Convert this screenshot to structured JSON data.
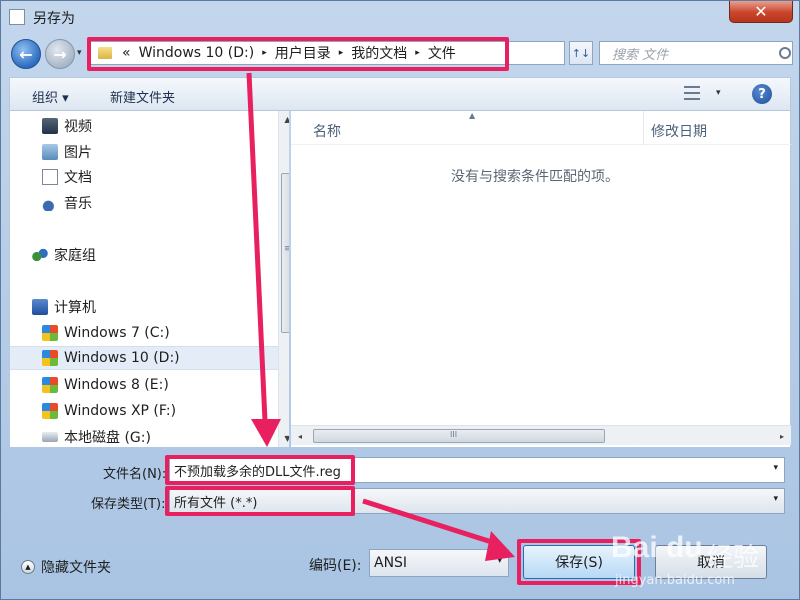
{
  "window": {
    "title": "另存为",
    "close_label": "✕"
  },
  "nav": {
    "back_glyph": "←",
    "forward_glyph": "→",
    "dropdown_glyph": "▾"
  },
  "address": {
    "prefix": "«",
    "crumbs": [
      "Windows 10 (D:)",
      "用户目录",
      "我的文档",
      "文件"
    ],
    "separator": "▸",
    "dropdown_glyph": "▾"
  },
  "refresh_glyph": "↑↓",
  "search": {
    "placeholder": "搜索 文件"
  },
  "toolbar": {
    "organize": "组织 ▾",
    "new_folder": "新建文件夹",
    "view_dropdown": "▾",
    "help": "?"
  },
  "sidebar": {
    "items": [
      {
        "label": "视频",
        "icon": "video-icon"
      },
      {
        "label": "图片",
        "icon": "pictures-icon"
      },
      {
        "label": "文档",
        "icon": "documents-icon"
      },
      {
        "label": "音乐",
        "icon": "music-icon"
      },
      {
        "label": "家庭组",
        "icon": "homegroup-icon"
      },
      {
        "label": "计算机",
        "icon": "computer-icon"
      },
      {
        "label": "Windows 7 (C:)",
        "icon": "drive-icon"
      },
      {
        "label": "Windows 10 (D:)",
        "icon": "drive-icon",
        "selected": true
      },
      {
        "label": "Windows 8 (E:)",
        "icon": "drive-icon"
      },
      {
        "label": "Windows XP (F:)",
        "icon": "drive-icon"
      },
      {
        "label": "本地磁盘 (G:)",
        "icon": "disk-icon"
      }
    ],
    "scroll_up": "▲",
    "scroll_down": "▼",
    "scroll_grip": "≡"
  },
  "filelist": {
    "columns": [
      "名称",
      "修改日期"
    ],
    "sort_glyph": "▲",
    "empty_message": "没有与搜索条件匹配的项。",
    "hscroll_left": "◂",
    "hscroll_right": "▸",
    "hscroll_grip": "III"
  },
  "form": {
    "filename_label": "文件名(N):",
    "filename_value": "不预加载多余的DLL文件.reg",
    "filetype_label": "保存类型(T):",
    "filetype_value": "所有文件 (*.*)",
    "encoding_label": "编码(E):",
    "encoding_value": "ANSI",
    "dropdown_glyph": "▾"
  },
  "footer": {
    "hide_folders": "隐藏文件夹",
    "hide_glyph": "▲",
    "save": "保存(S)",
    "cancel": "取消"
  },
  "watermark": {
    "logo": "Bai du",
    "cn": "经验",
    "url": "jingyan.baidu.com"
  },
  "colors": {
    "highlight": "#e8205f"
  }
}
